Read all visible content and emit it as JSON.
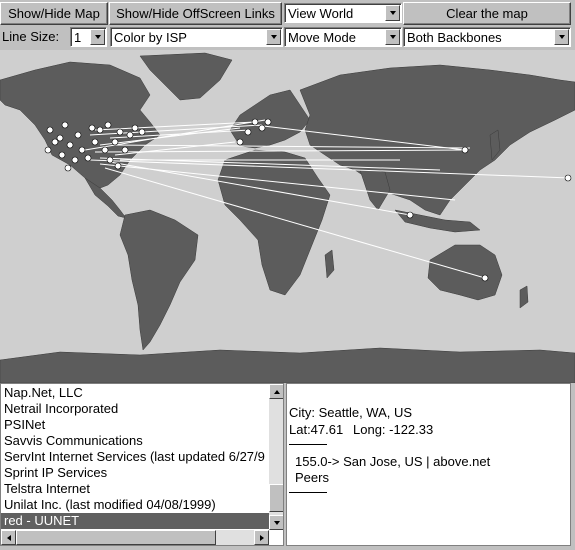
{
  "toolbar": {
    "show_hide_map": "Show/Hide Map",
    "show_hide_offscreen": "Show/Hide OffScreen Links",
    "view_select": "View World",
    "clear_map": "Clear the map",
    "line_size_label": "Line Size:",
    "line_size_value": "1",
    "color_select": "Color by ISP",
    "mode_select": "Move Mode",
    "backbone_select": "Both Backbones"
  },
  "isp_list": {
    "items": [
      "Nap.Net, LLC",
      "Netrail Incorporated",
      "PSINet",
      "Savvis Communications",
      "ServInt Internet Services (last updated 6/27/9",
      "Sprint IP Services",
      "Telstra Internet",
      "Unilat Inc. (last modified 04/08/1999)",
      "red - UUNET"
    ],
    "selected_index": 8
  },
  "info": {
    "city": "City: Seattle, WA, US",
    "lat": "Lat:47.61",
    "long": "Long: -122.33",
    "link": "155.0-> San Jose, US | above.net",
    "peers": "Peers"
  },
  "colors": {
    "link_line": "#ffffff",
    "node": "#ffffff",
    "land": "#5c5c5c",
    "ocean": "#cfcfcf",
    "selected_row": "#606060"
  }
}
